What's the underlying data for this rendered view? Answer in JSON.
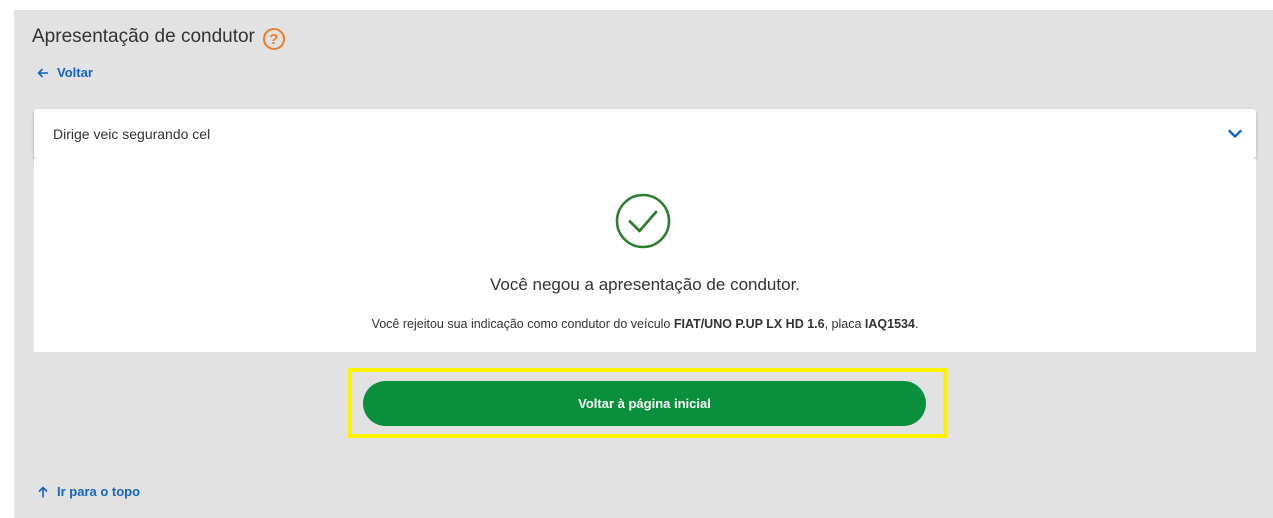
{
  "header": {
    "title": "Apresentação de condutor",
    "help_icon_glyph": "?",
    "back_label": "Voltar"
  },
  "accordion": {
    "title": "Dirige veic segurando cel"
  },
  "result": {
    "heading": "Você negou a apresentação de condutor.",
    "detail_prefix": "Você rejeitou sua indicação como condutor do veículo ",
    "vehicle": "FIAT/UNO P.UP LX HD 1.6",
    "detail_middle": ", placa ",
    "plate": "IAQ1534",
    "detail_suffix": "."
  },
  "actions": {
    "home_button_label": "Voltar à página inicial"
  },
  "footer": {
    "top_link_label": "Ir para o topo"
  },
  "colors": {
    "accent_orange": "#ee7d24",
    "link_blue": "#1565c0",
    "success_green": "#2e7d32",
    "button_green": "#0a8f3c",
    "highlight_yellow": "#fff200"
  },
  "icons": [
    "help-icon",
    "arrow-left-icon",
    "chevron-down-icon",
    "check-circle-icon",
    "arrow-up-icon"
  ]
}
